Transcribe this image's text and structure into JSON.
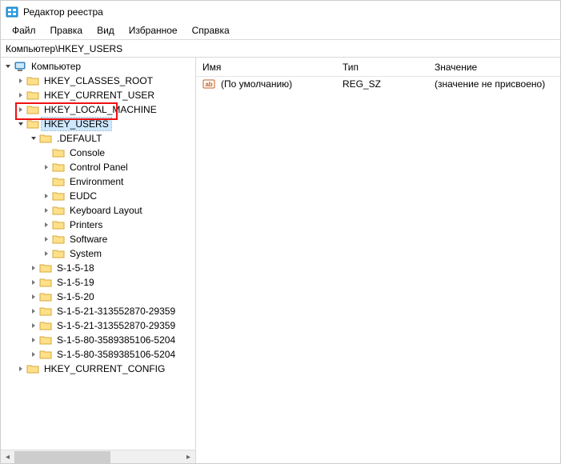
{
  "window": {
    "title": "Редактор реестра"
  },
  "menu": {
    "file": "Файл",
    "edit": "Правка",
    "view": "Вид",
    "favorites": "Избранное",
    "help": "Справка"
  },
  "address": "Компьютер\\HKEY_USERS",
  "tree": {
    "root": "Компьютер",
    "hkcr": "HKEY_CLASSES_ROOT",
    "hkcu": "HKEY_CURRENT_USER",
    "hklm": "HKEY_LOCAL_MACHINE",
    "hku": "HKEY_USERS",
    "default": ".DEFAULT",
    "console": "Console",
    "controlpanel": "Control Panel",
    "environment": "Environment",
    "eudc": "EUDC",
    "keyboard": "Keyboard Layout",
    "printers": "Printers",
    "software": "Software",
    "system": "System",
    "s18": "S-1-5-18",
    "s19": "S-1-5-19",
    "s20": "S-1-5-20",
    "s21a": "S-1-5-21-313552870-29359",
    "s21b": "S-1-5-21-313552870-29359",
    "s80a": "S-1-5-80-3589385106-5204",
    "s80b": "S-1-5-80-3589385106-5204",
    "hkcc": "HKEY_CURRENT_CONFIG"
  },
  "list": {
    "headers": {
      "name": "Имя",
      "type": "Тип",
      "value": "Значение"
    },
    "rows": [
      {
        "name": "(По умолчанию)",
        "type": "REG_SZ",
        "value": "(значение не присвоено)"
      }
    ]
  }
}
